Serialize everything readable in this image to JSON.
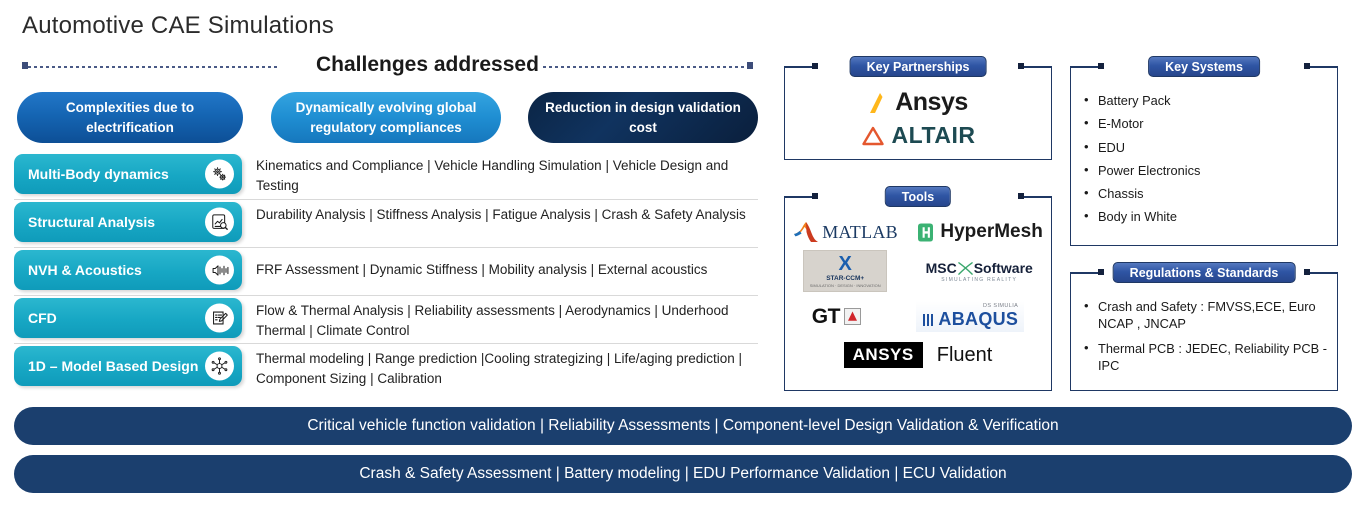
{
  "title": "Automotive CAE Simulations",
  "header": {
    "challenges_label": "Challenges addressed"
  },
  "challenge_pills": [
    {
      "label": "Complexities due to electrification",
      "color": "#1565b3"
    },
    {
      "label": "Dynamically evolving global regulatory compliances",
      "color": "#1f8ed2"
    },
    {
      "label": "Reduction in design validation cost",
      "color": "#0b2545"
    }
  ],
  "disciplines": [
    {
      "label": "Multi-Body dynamics",
      "icon": "gears-icon",
      "description": "Kinematics and Compliance | Vehicle Handling Simulation | Vehicle Design and Testing"
    },
    {
      "label": "Structural Analysis",
      "icon": "chart-magnifier-icon",
      "description": "Durability Analysis | Stiffness Analysis | Fatigue Analysis | Crash & Safety Analysis"
    },
    {
      "label": "NVH & Acoustics",
      "icon": "speaker-waveform-icon",
      "description": "FRF Assessment | Dynamic Stiffness | Mobility analysis | External acoustics"
    },
    {
      "label": "CFD",
      "icon": "clipboard-pencil-icon",
      "description": "Flow & Thermal Analysis | Reliability assessments | Aerodynamics | Underhood Thermal | Climate Control"
    },
    {
      "label": "1D – Model Based Design",
      "icon": "node-network-icon",
      "description": "Thermal modeling | Range prediction |Cooling strategizing | Life/aging prediction | Component Sizing | Calibration"
    }
  ],
  "panels": {
    "key_partnerships": {
      "title": "Key Partnerships",
      "logos": [
        {
          "name": "ansys-logo",
          "text": "Ansys"
        },
        {
          "name": "altair-logo",
          "text": "ALTAIR"
        }
      ]
    },
    "tools": {
      "title": "Tools",
      "logos": [
        {
          "name": "matlab-logo",
          "text": "MATLAB"
        },
        {
          "name": "hypermesh-logo",
          "text": "HyperMesh"
        },
        {
          "name": "star-ccm-logo",
          "text": "X",
          "sub": "STAR-CCM+",
          "sub2": "SIMULATION  ·  DESIGN  ·  INNOVATION"
        },
        {
          "name": "msc-software-logo",
          "text": "MSC",
          "text2": "Software",
          "sub": "SIMULATING REALITY"
        },
        {
          "name": "gt-logo",
          "text": "GT"
        },
        {
          "name": "abaqus-logo",
          "text": "ABAQUS",
          "sub": "DS SIMULIA"
        },
        {
          "name": "ansys-fluent-logo",
          "text": "ANSYS",
          "text2": "Fluent"
        }
      ]
    },
    "key_systems": {
      "title": "Key Systems",
      "items": [
        "Battery Pack",
        "E-Motor",
        "EDU",
        "Power Electronics",
        "Chassis",
        "Body in White"
      ]
    },
    "regulations": {
      "title": "Regulations & Standards",
      "items": [
        "Crash and Safety : FMVSS,ECE, Euro NCAP , JNCAP",
        "Thermal PCB : JEDEC, Reliability PCB - IPC"
      ]
    }
  },
  "banners": [
    "Critical vehicle function validation | Reliability Assessments | Component-level Design Validation & Verification",
    "Crash & Safety Assessment | Battery modeling | EDU Performance Validation | ECU Validation"
  ]
}
